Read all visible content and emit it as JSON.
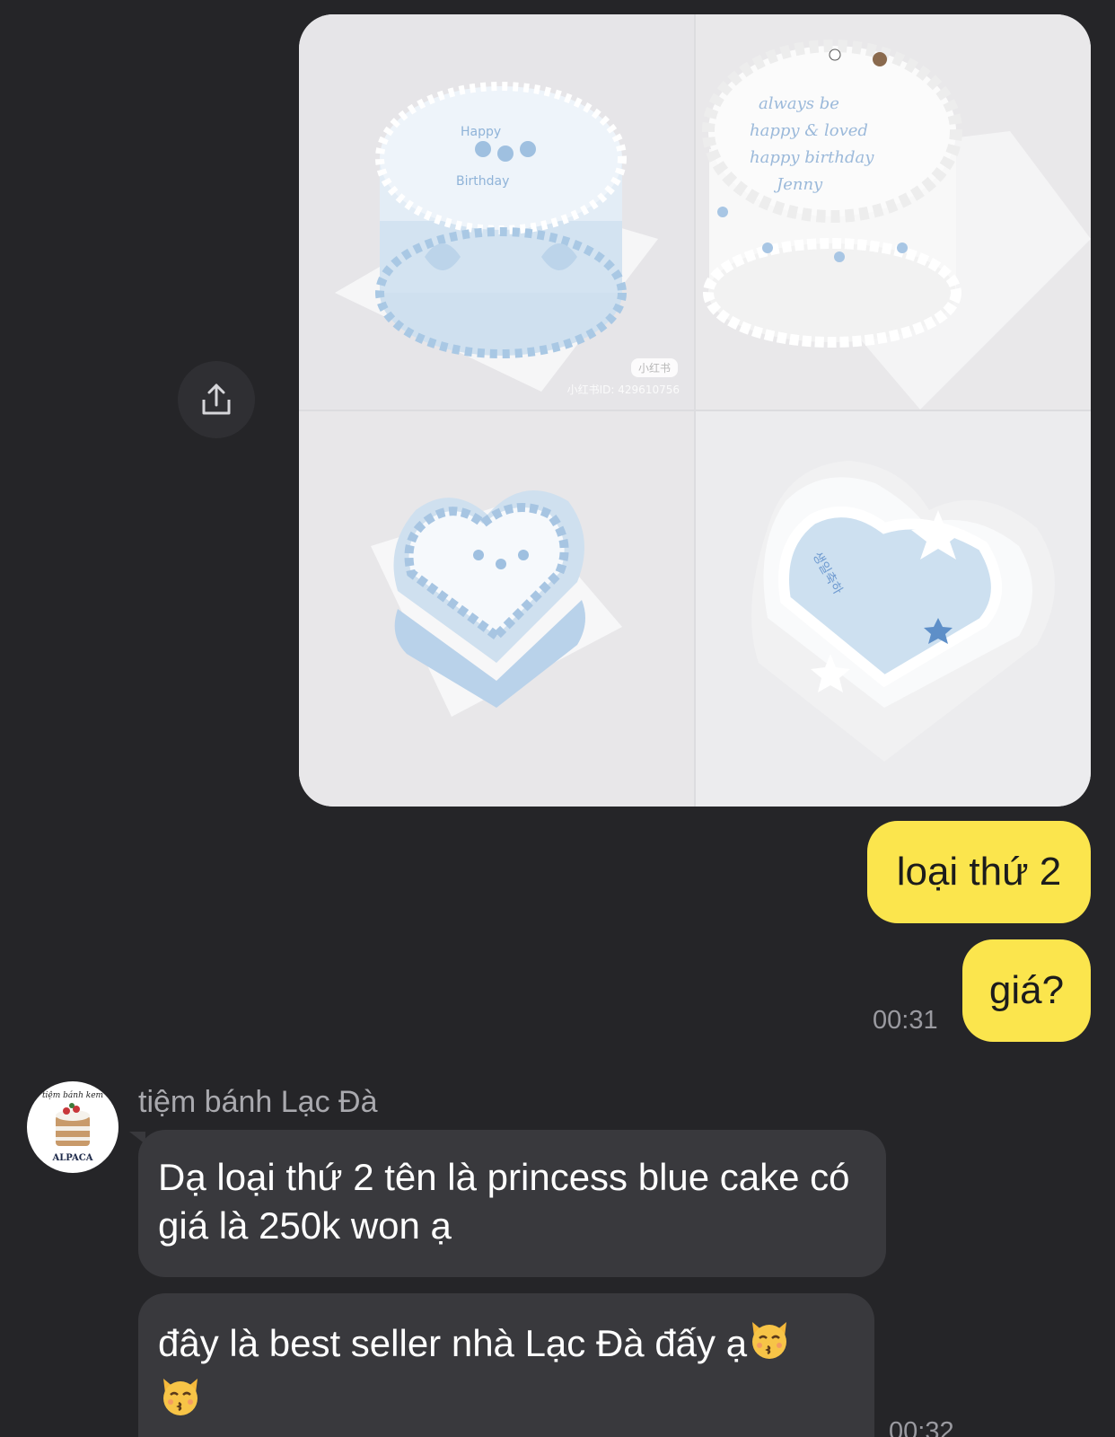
{
  "share": {
    "icon": "share-upload-icon"
  },
  "photos": [
    {
      "name": "round-blue-birthday-cake",
      "watermark": "小红书ID: 429610756",
      "logo": "小红书"
    },
    {
      "name": "round-white-lettered-cake"
    },
    {
      "name": "heart-cake-blue-frosting"
    },
    {
      "name": "heart-cake-blue-stars"
    }
  ],
  "messages_out": [
    {
      "text": "loại thứ 2"
    },
    {
      "text": "giá?",
      "time": "00:31"
    }
  ],
  "incoming": {
    "sender": "tiệm bánh Lạc Đà",
    "avatar_text": {
      "top": "tiệm bánh kem",
      "bottom": "ALPACA"
    },
    "messages": [
      {
        "text": "Dạ loại thứ 2 tên là princess blue cake có giá là 250k won ạ"
      },
      {
        "text": "đây là best seller nhà Lạc Đà đấy ạ",
        "emoji": "kissing-cat-emoji",
        "time": "00:32"
      }
    ]
  },
  "colors": {
    "background": "#252528",
    "outgoing_bubble": "#fbe54d",
    "incoming_bubble": "#39393d"
  }
}
